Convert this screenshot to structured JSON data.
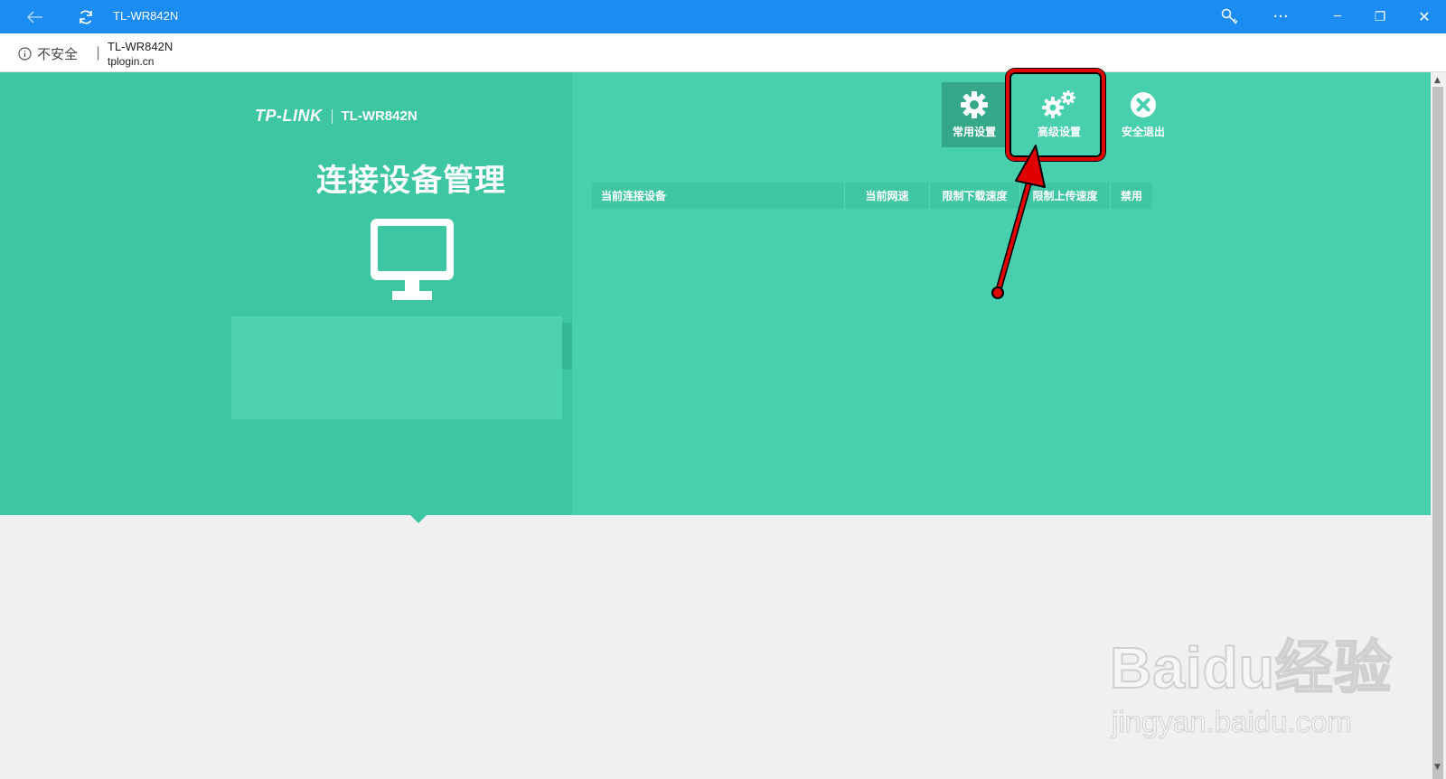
{
  "titlebar": {
    "title": "TL-WR842N",
    "back_icon": "arrow-left-icon",
    "refresh_icon": "refresh-icon",
    "key_icon": "key-icon",
    "more_icon": "ellipsis-icon",
    "more_label": "···",
    "minimize_label": "─",
    "restore_label": "❐",
    "close_label": "✕"
  },
  "addressbar": {
    "insecure_label": "不安全",
    "separator": "|",
    "page_title": "TL-WR842N",
    "url": "tplogin.cn"
  },
  "left_panel": {
    "brand": "TP-LINK",
    "model": "TL-WR842N",
    "heading": "连接设备管理",
    "icon": "monitor-icon"
  },
  "nav": {
    "common_label": "常用设置",
    "advanced_label": "高级设置",
    "exit_label": "安全退出"
  },
  "table": {
    "columns": [
      "当前连接设备",
      "当前网速",
      "限制下载速度",
      "限制上传速度",
      "禁用"
    ],
    "rows": []
  },
  "watermark": {
    "main": "Baidu经验",
    "sub": "jingyan.baidu.com"
  },
  "colors": {
    "titlebar": "#1b8cf2",
    "green": "#48cfad",
    "green_dark": "#3ec5a2",
    "highlight": "#e00000"
  }
}
